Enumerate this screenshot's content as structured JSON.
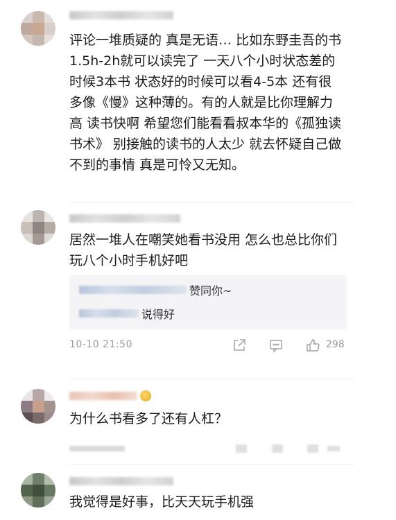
{
  "comments": [
    {
      "text": "评论一堆质疑的 真是无语… 比如东野圭吾的书 1.5h-2h就可以读完了 一天八个小时状态差的时候3本书 状态好的时候可以看4-5本  还有很多像《慢》这种薄的。有的人就是比你理解力高 读书快啊  希望您们能看看叔本华的《孤独读书术》 别接触的读书的人太少 就去怀疑自己做不到的事情 真是可怜又无知。"
    },
    {
      "text": "居然一堆人在嘲笑她看书没用 怎么也总比你们玩八个小时手机好吧",
      "replies": [
        {
          "text": "赞同你~"
        },
        {
          "text": "说得好"
        }
      ],
      "time": "10-10 21:50",
      "likes": "298",
      "icons": [
        "share-icon",
        "comment-icon",
        "like-icon"
      ]
    },
    {
      "text": "为什么书看多了还有人杠？"
    },
    {
      "text": "我觉得是好事，比天天玩手机强"
    }
  ],
  "colors": {
    "background": "#ffffff",
    "text": "#1c1c1c",
    "meta": "#9a9a9a",
    "reply_bg": "#f4f4f6"
  }
}
